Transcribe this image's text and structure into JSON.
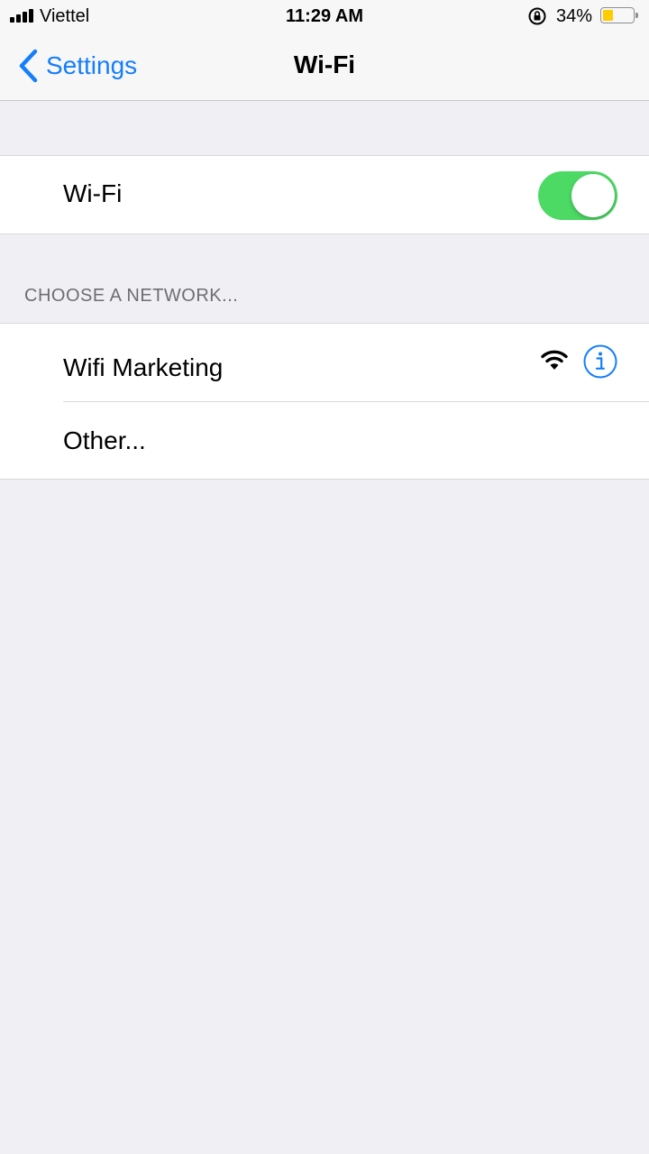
{
  "status_bar": {
    "carrier": "Viettel",
    "time": "11:29 AM",
    "battery_percent": "34%",
    "battery_level": 0.34,
    "icons": [
      "signal-icon",
      "orientation-lock-icon",
      "battery-icon"
    ]
  },
  "nav": {
    "back_label": "Settings",
    "title": "Wi-Fi"
  },
  "wifi_toggle": {
    "label": "Wi-Fi",
    "on": true
  },
  "networks": {
    "header": "CHOOSE A NETWORK...",
    "items": [
      {
        "name": "Wifi Marketing",
        "icons": [
          "wifi-signal-icon",
          "info-icon"
        ]
      },
      {
        "name": "Other..."
      }
    ]
  },
  "colors": {
    "accent": "#157efb",
    "toggle_on": "#4cd964",
    "background": "#efeff4",
    "battery": "#ffcc00"
  }
}
